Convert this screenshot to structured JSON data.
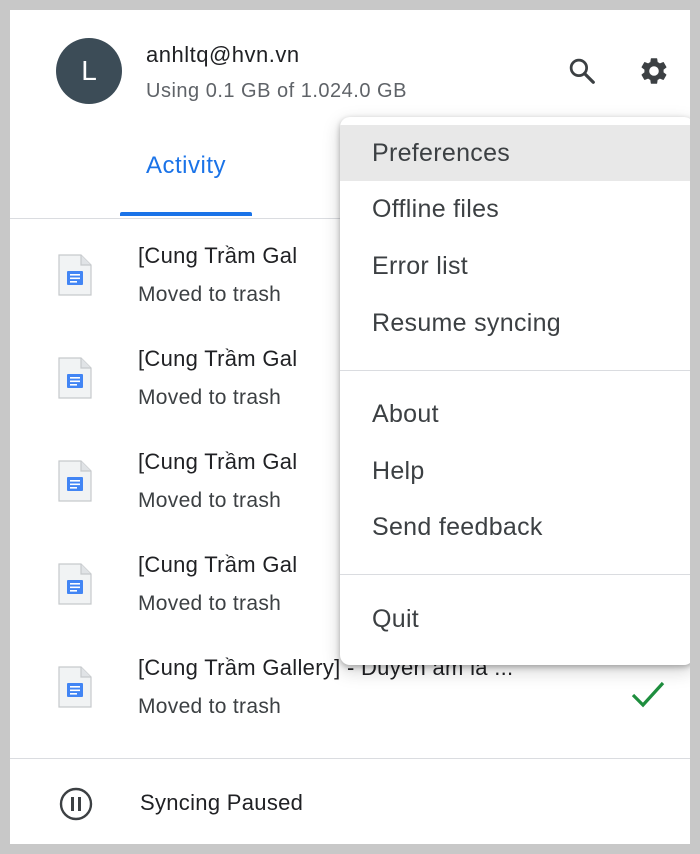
{
  "account": {
    "avatar_letter": "L",
    "email": "anhltq@hvn.vn",
    "usage": "Using 0.1 GB of 1.024.0 GB"
  },
  "header": {
    "search_icon": "search-icon",
    "settings_icon": "gear-icon"
  },
  "tabs": [
    {
      "label": "Activity",
      "active": true
    }
  ],
  "activity": [
    {
      "title": "[Cung Trầm Gal",
      "subtitle": "Moved to trash"
    },
    {
      "title": "[Cung Trầm Gal",
      "subtitle": "Moved to trash"
    },
    {
      "title": "[Cung Trầm Gal",
      "subtitle": "Moved to trash"
    },
    {
      "title": "[Cung Trầm Gal",
      "subtitle": "Moved to trash"
    },
    {
      "title": "[Cung Trầm Gallery] - Duyên âm là ...",
      "subtitle": "Moved to trash",
      "status_icon": "check-icon"
    }
  ],
  "footer": {
    "status": "Syncing Paused",
    "icon": "pause-circle-icon"
  },
  "menu": {
    "items": [
      {
        "label": "Preferences",
        "highlighted": true
      },
      {
        "label": "Offline files"
      },
      {
        "label": "Error list"
      },
      {
        "label": "Resume syncing"
      },
      {
        "label": "About"
      },
      {
        "label": "Help"
      },
      {
        "label": "Send feedback"
      },
      {
        "label": "Quit"
      }
    ]
  },
  "colors": {
    "accent": "#1a73e8",
    "avatar_bg": "#3c4c57",
    "check": "#1e8e3e",
    "doc_icon": "#4285f4"
  }
}
